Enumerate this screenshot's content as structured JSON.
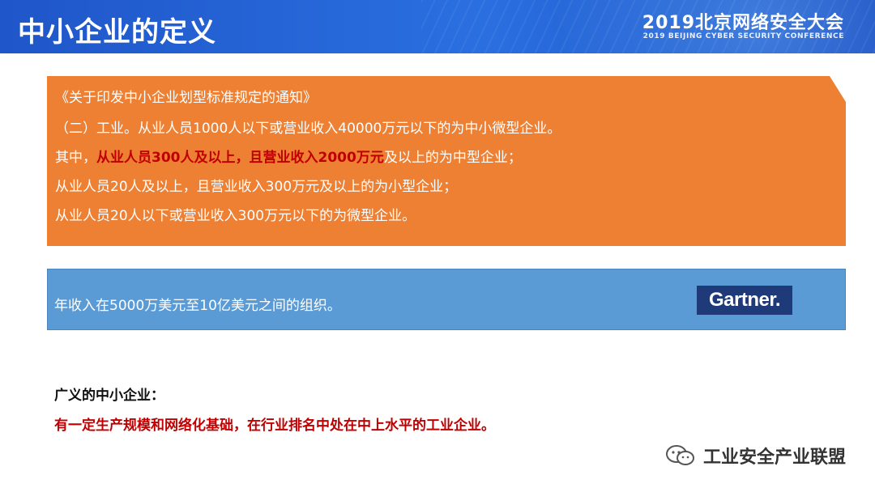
{
  "header": {
    "title": "中小企业的定义",
    "conference_cn": "2019北京网络安全大会",
    "conference_en": "2019 BEIJING CYBER SECURITY CONFERENCE"
  },
  "orange_box": {
    "line1": "《关于印发中小企业划型标准规定的通知》",
    "line2": "（二）工业。从业人员1000人以下或营业收入40000万元以下的为中小微型企业。",
    "line3_a": "其中，",
    "line3_b": "从业人员300人及以上",
    "line3_c": "，且",
    "line3_d": "营业收入2000万元",
    "line3_e": "及以上的为中型企业；",
    "line4": "从业人员20人及以上，且营业收入300万元及以上的为小型企业；",
    "line5": "从业人员20人以下或营业收入300万元以下的为微型企业。"
  },
  "blue_box": {
    "text": "年收入在5000万美元至10亿美元之间的组织。",
    "logo_text": "Gartner."
  },
  "bottom": {
    "heading": "广义的中小企业：",
    "text": "有一定生产规模和网络化基础，在行业排名中处在中上水平的工业企业。"
  },
  "watermark": {
    "icon": "wechat-icon",
    "text": "工业安全产业联盟"
  },
  "colors": {
    "header_blue": "#1f56c9",
    "orange": "#ee8034",
    "blue_box": "#5b9bd5",
    "highlight_red": "#c00000",
    "gartner_navy": "#1e3a78"
  }
}
